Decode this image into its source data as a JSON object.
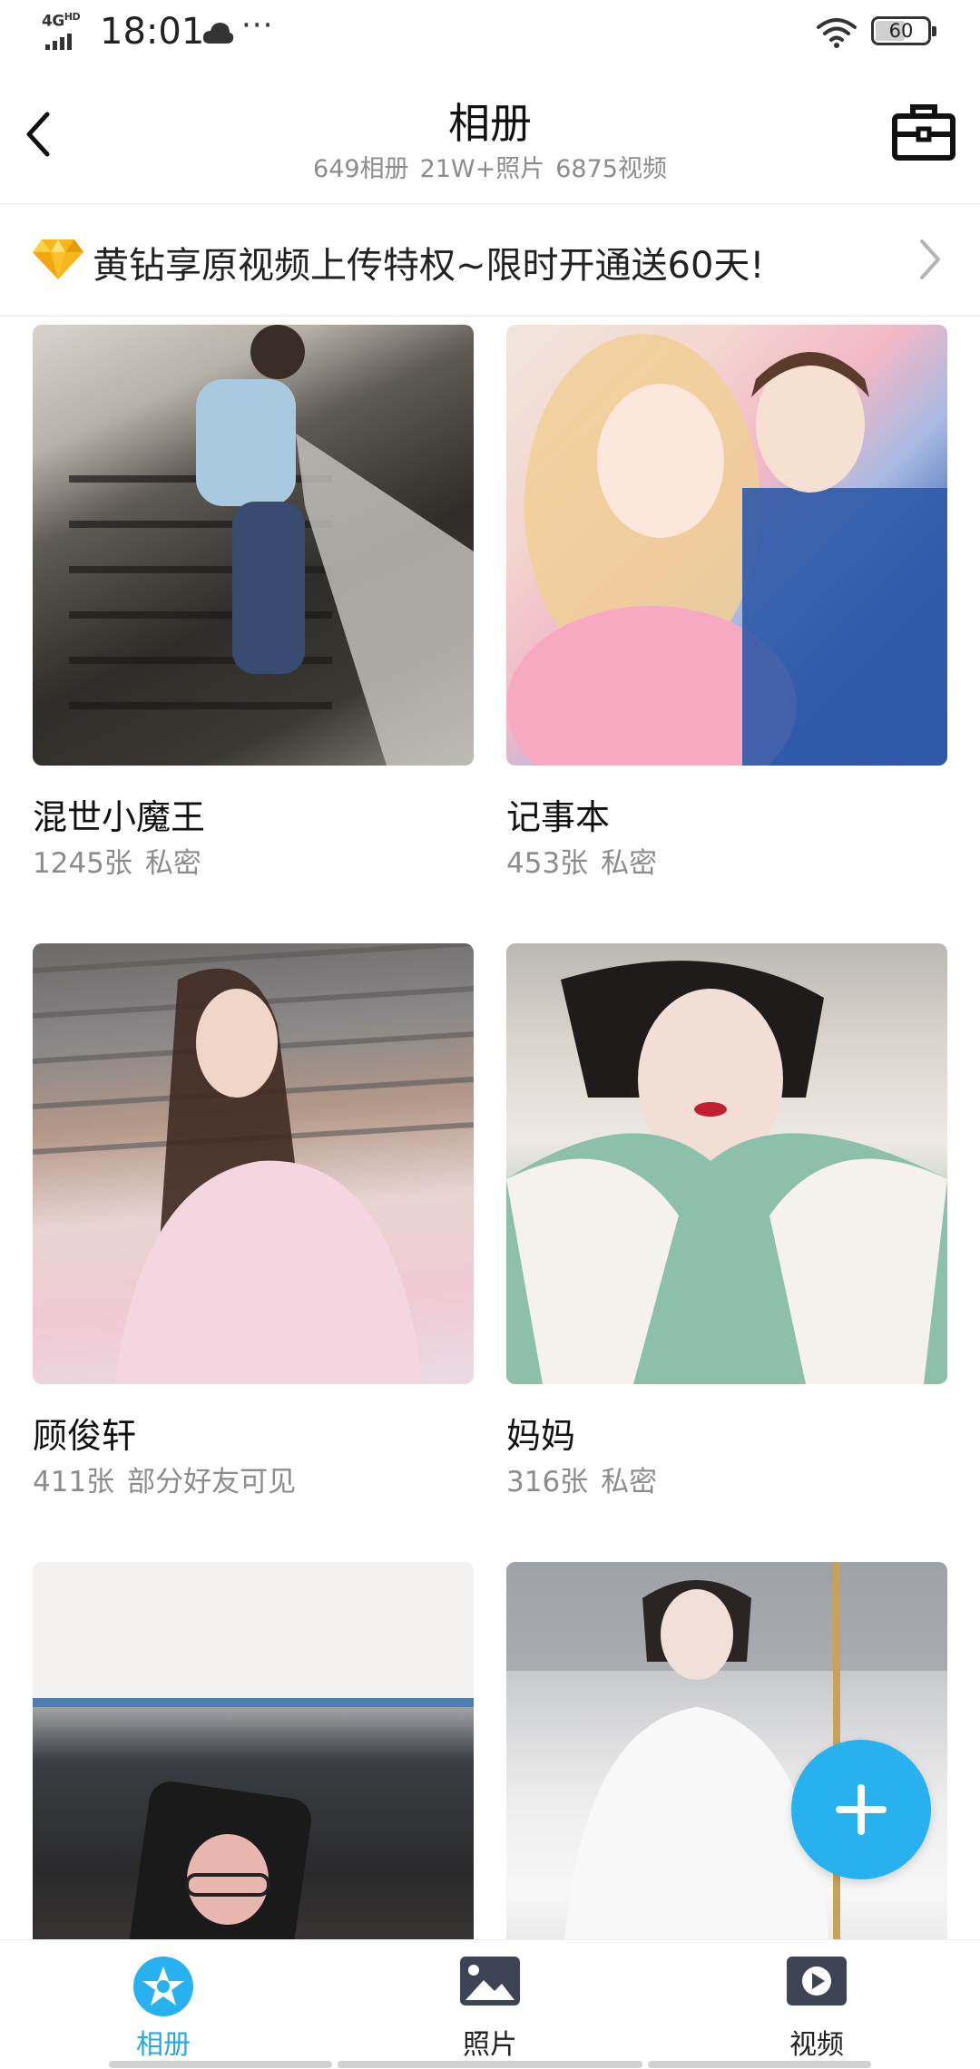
{
  "status_bar": {
    "network": "4G",
    "network_sup": "HD",
    "time": "18:01",
    "more": "···",
    "battery": "60"
  },
  "header": {
    "title": "相册",
    "stats": {
      "albums": "649相册",
      "photos": "21W+照片",
      "videos": "6875视频"
    }
  },
  "promo": {
    "text": "黄钻享原视频上传特权~限时开通送60天!"
  },
  "albums": [
    {
      "name": "混世小魔王",
      "count": "1245张",
      "privacy": "私密"
    },
    {
      "name": "记事本",
      "count": "453张",
      "privacy": "私密"
    },
    {
      "name": "顾俊轩",
      "count": "411张",
      "privacy": "部分好友可见"
    },
    {
      "name": "妈妈",
      "count": "316张",
      "privacy": "私密"
    },
    {
      "name": "",
      "count": "",
      "privacy": ""
    },
    {
      "name": "",
      "count": "",
      "privacy": ""
    }
  ],
  "bottom_nav": [
    {
      "label": "相册",
      "icon": "album-icon",
      "active": true
    },
    {
      "label": "照片",
      "icon": "photo-icon",
      "active": false
    },
    {
      "label": "视频",
      "icon": "video-icon",
      "active": false
    }
  ],
  "colors": {
    "accent": "#27b1ee",
    "active_tab": "#27a9e3",
    "secondary_text": "#8c8c8c"
  }
}
